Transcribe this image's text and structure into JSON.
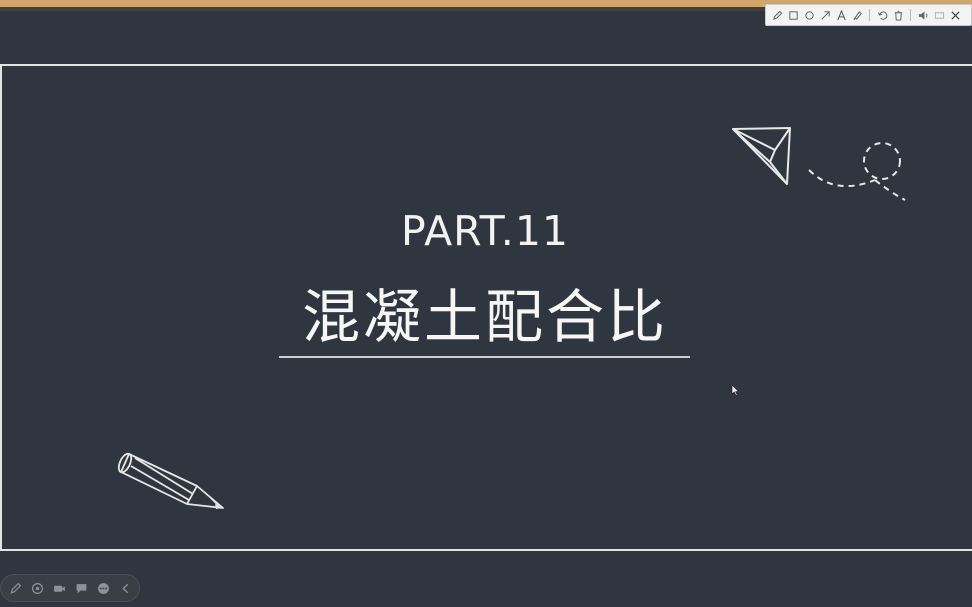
{
  "slide": {
    "part_label": "PART.11",
    "title": "混凝土配合比"
  },
  "annotation_toolbar": {
    "tools": [
      {
        "name": "pen-icon",
        "glyph": "✎"
      },
      {
        "name": "rectangle-icon",
        "glyph": "□"
      },
      {
        "name": "circle-icon",
        "glyph": "○"
      },
      {
        "name": "arrow-icon",
        "glyph": "↗"
      },
      {
        "name": "text-icon",
        "glyph": "A"
      },
      {
        "name": "highlighter-icon",
        "glyph": "✐"
      },
      {
        "name": "undo-icon",
        "glyph": "↺"
      },
      {
        "name": "delete-icon",
        "glyph": "🗑"
      },
      {
        "name": "volume-icon",
        "glyph": "◂"
      },
      {
        "name": "screen-icon",
        "glyph": "▭"
      },
      {
        "name": "close-icon",
        "glyph": "✕"
      }
    ]
  },
  "colors": {
    "background": "#2f3640",
    "frame_line": "#dfe3e6",
    "top_strip": "#d2a66b",
    "text": "#f2f2f2"
  }
}
